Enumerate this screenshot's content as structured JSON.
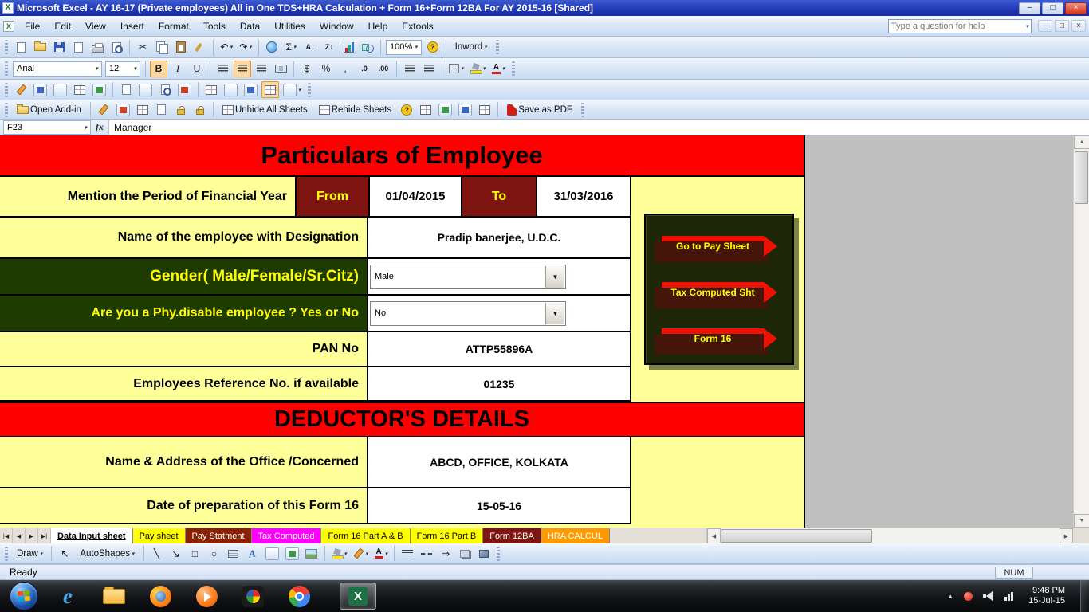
{
  "window": {
    "title": "Microsoft Excel - AY 16-17 (Private employees)  All in One TDS+HRA Calculation + Form 16+Form 12BA For AY 2015-16  [Shared]"
  },
  "menu": {
    "items": [
      "File",
      "Edit",
      "View",
      "Insert",
      "Format",
      "Tools",
      "Data",
      "Utilities",
      "Window",
      "Help",
      "Extools"
    ],
    "question_placeholder": "Type a question for help"
  },
  "toolbars": {
    "zoom_value": "100%",
    "inword_label": "Inword",
    "font_name": "Arial",
    "font_size": "12",
    "open_addin": "Open Add-in",
    "unhide_sheets": "Unhide All Sheets",
    "rehide_sheets": "Rehide Sheets",
    "save_as_pdf": "Save as PDF",
    "draw_label": "Draw",
    "autoshapes_label": "AutoShapes"
  },
  "formula_bar": {
    "cell_ref": "F23",
    "fx_label": "fx",
    "value": "Manager"
  },
  "form": {
    "section1_title": "Particulars of Employee",
    "period": {
      "label": "Mention the Period of Financial Year",
      "from_label": "From",
      "from_value": "01/04/2015",
      "to_label": "To",
      "to_value": "31/03/2016"
    },
    "name": {
      "label": "Name of the employee with Designation",
      "value": "Pradip banerjee, U.D.C."
    },
    "gender": {
      "label": "Gender( Male/Female/Sr.Citz)",
      "value": "Male"
    },
    "disability": {
      "label": "Are you a Phy.disable employee ? Yes or No",
      "value": "No"
    },
    "pan": {
      "label": "PAN No",
      "value": "ATTP55896A"
    },
    "reference": {
      "label": "Employees Reference No. if available",
      "value": "01235"
    },
    "section2_title": "DEDUCTOR'S DETAILS",
    "office": {
      "label": "Name  & Address of the Office /Concerned",
      "value": "ABCD, OFFICE, KOLKATA"
    },
    "prep_date": {
      "label": "Date of preparation of this Form 16",
      "value": "15-05-16"
    },
    "nav_buttons": [
      "Go to Pay Sheet",
      "Tax Computed Sht",
      "Form 16"
    ]
  },
  "sheet_tabs": [
    {
      "label": "Data Input sheet",
      "active": true
    },
    {
      "label": "Pay sheet"
    },
    {
      "label": "Pay Statment"
    },
    {
      "label": "Tax Computed"
    },
    {
      "label": "Form 16 Part A & B"
    },
    {
      "label": "Form 16 Part B"
    },
    {
      "label": "Form 12BA"
    },
    {
      "label": "HRA CALCUL"
    }
  ],
  "status_bar": {
    "mode": "Ready",
    "num": "NUM"
  },
  "taskbar": {
    "time": "9:48 PM",
    "date": "15-Jul-15"
  },
  "colors": {
    "banner_red": "#ff0000",
    "cell_yellow": "#ffff99",
    "maroon": "#7e1410",
    "dark_green": "#1e3b00",
    "nav_box": "#1d2607",
    "arrow_red": "#ee1000",
    "arrow_text_yellow": "#ffff00",
    "tab_yellow": "#ffff00",
    "tab_magenta": "#ff00ff",
    "tab_orange": "#ff9900"
  },
  "glyphs": {
    "excel_x": "X",
    "minimize": "–",
    "maximize": "□",
    "close": "×",
    "dropdown": "▾",
    "combo_arrow": "▼",
    "bold": "B",
    "italic": "I",
    "underline": "U",
    "sum": "Σ",
    "currency": "$",
    "percent": "%",
    "comma": ",",
    "inc_decimal": ".0",
    "dec_decimal": ".00",
    "undo": "↶",
    "redo": "↷",
    "cut": "✂",
    "help": "?",
    "question": "?",
    "sort_az": "A↓",
    "sort_za": "Z↓",
    "pointer": "↖",
    "line": "╲",
    "arrow": "↘",
    "rect": "□",
    "oval": "○",
    "arrow_style": "⇒",
    "wordart": "A",
    "tab_first": "|◀",
    "tab_prev": "◀",
    "tab_next": "▶",
    "tab_last": "▶|",
    "up": "▲",
    "down": "▼",
    "left": "◀",
    "right": "▶",
    "ie": "e"
  }
}
